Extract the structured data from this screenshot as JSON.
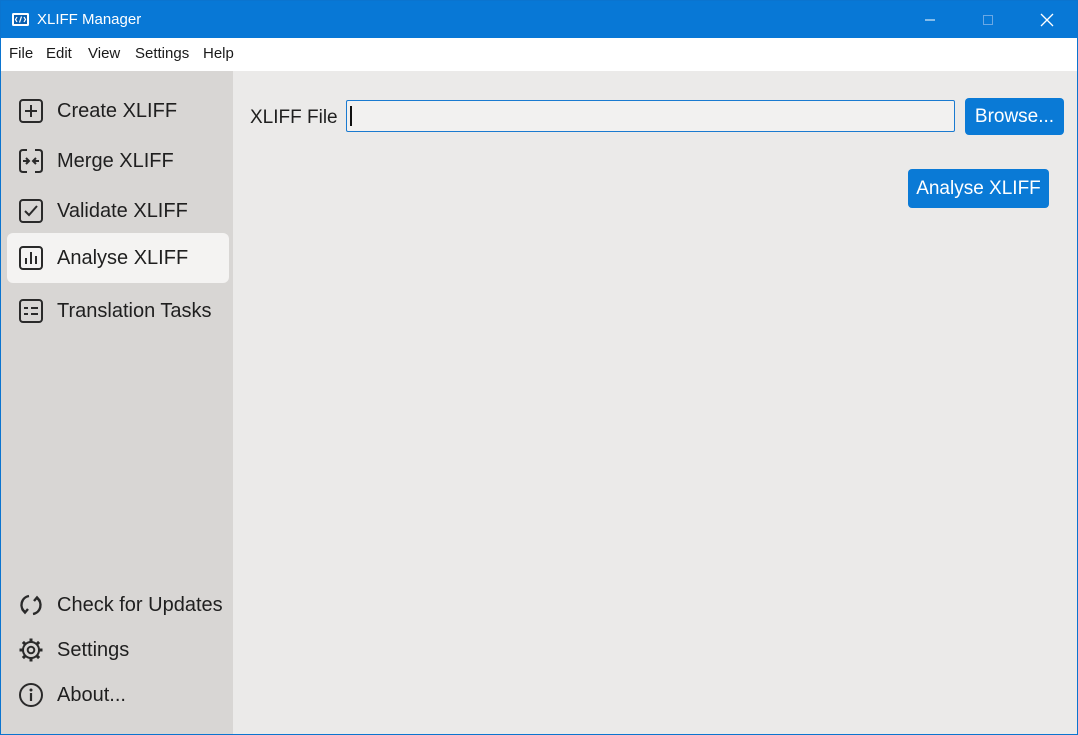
{
  "window": {
    "title": "XLIFF Manager",
    "controls": {
      "minimize_icon": "minimize-icon",
      "maximize_icon": "maximize-icon",
      "close_icon": "close-icon"
    }
  },
  "menu": [
    "File",
    "Edit",
    "View",
    "Settings",
    "Help"
  ],
  "sidebar": {
    "items": [
      {
        "label": "Create XLIFF",
        "icon": "plus-square-icon"
      },
      {
        "label": "Merge XLIFF",
        "icon": "merge-icon"
      },
      {
        "label": "Validate XLIFF",
        "icon": "check-square-icon"
      },
      {
        "label": "Analyse XLIFF",
        "icon": "bar-chart-icon",
        "active": true
      },
      {
        "label": "Translation Tasks",
        "icon": "task-list-icon"
      }
    ],
    "footer": [
      {
        "label": "Check for Updates",
        "icon": "refresh-icon"
      },
      {
        "label": "Settings",
        "icon": "gear-icon"
      },
      {
        "label": "About...",
        "icon": "info-icon"
      }
    ]
  },
  "main": {
    "file_label": "XLIFF File",
    "file_value": "",
    "browse_label": "Browse...",
    "analyse_label": "Analyse XLIFF"
  },
  "colors": {
    "accent": "#0a7ad6",
    "titlebar": "#0878d6",
    "sidebar": "#d8d6d4",
    "content": "#ebeae9"
  }
}
